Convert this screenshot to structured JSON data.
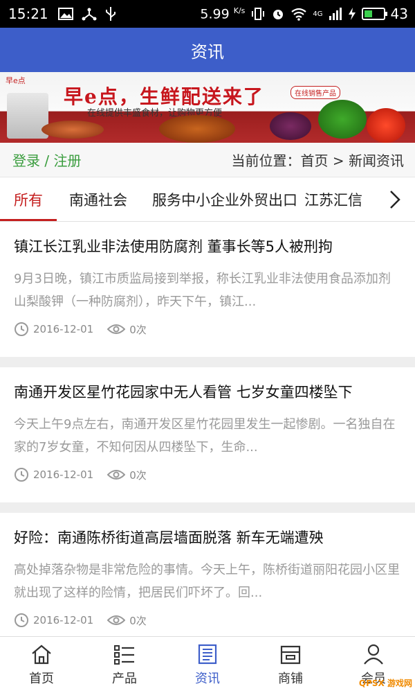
{
  "status_bar": {
    "time": "15:21",
    "speed": "5.99",
    "speed_unit": "K/s",
    "network": "4G",
    "battery": "43",
    "battery_level": 0.43
  },
  "header": {
    "title": "资讯"
  },
  "banner": {
    "brand": "早e点",
    "headline": "早e点，生鲜配送来了",
    "subline": "在线提供丰盛食材，让购物更方便",
    "tag": "在线销售产品"
  },
  "crumb": {
    "login": "登录",
    "separator": "/",
    "register": "注册",
    "position": "当前位置：首页 > 新闻资讯"
  },
  "tabs": [
    {
      "label": "所有",
      "active": true
    },
    {
      "label": "南通社会",
      "active": false
    },
    {
      "label": "服务中小企业外贸出口",
      "active": false
    },
    {
      "label": "江苏汇信",
      "active": false
    }
  ],
  "news": [
    {
      "title": "镇江长江乳业非法使用防腐剂 董事长等5人被刑拘",
      "summary": "9月3日晚，镇江市质监局接到举报，称长江乳业非法使用食品添加剂山梨酸钾（一种防腐剂），昨天下午，镇江...",
      "date": "2016-12-01",
      "views": "0次"
    },
    {
      "title": "南通开发区星竹花园家中无人看管 七岁女童四楼坠下",
      "summary": "今天上午9点左右，南通开发区星竹花园里发生一起惨剧。一名独自在家的7岁女童，不知何因从四楼坠下，生命...",
      "date": "2016-12-01",
      "views": "0次"
    },
    {
      "title": "好险：南通陈桥街道高层墙面脱落 新车无端遭殃",
      "summary": "高处掉落杂物是非常危险的事情。今天上午，陈桥街道丽阳花园小区里就出现了这样的险情，把居民们吓坏了。回...",
      "date": "2016-12-01",
      "views": "0次"
    }
  ],
  "bottom_nav": [
    {
      "label": "首页",
      "icon": "home-icon",
      "active": false
    },
    {
      "label": "产品",
      "icon": "list-icon",
      "active": false
    },
    {
      "label": "资讯",
      "icon": "news-icon",
      "active": true
    },
    {
      "label": "商铺",
      "icon": "shop-icon",
      "active": false
    },
    {
      "label": "会员",
      "icon": "user-icon",
      "active": false
    }
  ],
  "watermark": "QPSX 游戏网",
  "colors": {
    "header_blue": "#3d5ec9",
    "accent_red": "#c41e1e",
    "login_green": "#3a9d3e"
  }
}
